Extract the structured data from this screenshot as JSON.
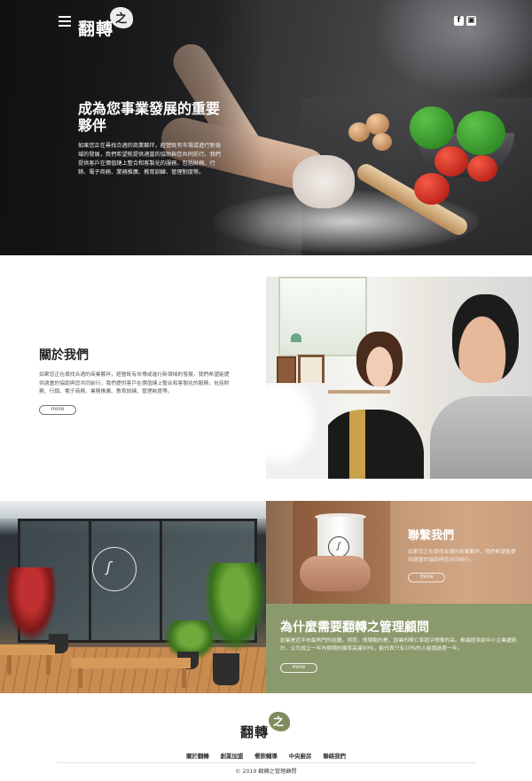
{
  "header": {
    "logo_text": "翻轉",
    "logo_badge": "之",
    "social": [
      {
        "icon": "facebook-icon",
        "glyph": "f"
      },
      {
        "icon": "line-icon",
        "glyph": "▣"
      }
    ]
  },
  "hero": {
    "title": "成為您事業發展的重要夥伴",
    "description": "如果您正在尋找合適的商業夥伴，經營既有市場或進行新領域的發展，我們希望能提供適當的協助與您共同前行。我們提供客戶在價值鏈上整合和客製化的服務，包括財務、行銷、電子商務、業務推廣、教育訓練、管理制度等。"
  },
  "about": {
    "title": "關於我們",
    "description": "如果您正在尋找合適的商業夥伴，經營既有市場或進行新領域的發展，我們希望能提供適當的協助與您共同前行，我們提供客戶在價值鏈上整合和客製化的服務，包括財務、行銷、電子商務、業務推廣、教育訓練、管理制度等。",
    "button": "more"
  },
  "cafe": {
    "sign_glyph": "ʃ"
  },
  "contact": {
    "title": "聯繫我們",
    "description": "如果您正在尋找合適的商業夥伴，我們希望能提供適當的協助與您共同前行。",
    "button": "more",
    "cup_glyph": "ʃ"
  },
  "why": {
    "title": "為什麼需要翻轉之管理顧問",
    "description": "創業是近年來最熱門的話題，然而，很殘酷的是，創業的陣亡率超乎想像的高。根據經濟部中小企業處統計，公司成立一年內倒閉的機率高達90%，能代表只有10%的人能撐過第一年。",
    "button": "more"
  },
  "footer": {
    "logo_text": "翻轉",
    "logo_badge": "之",
    "nav": [
      "關於翻轉",
      "創業加盟",
      "餐飲輔導",
      "中央廚房",
      "聯絡我們"
    ],
    "copyright": "© 2019 翻轉之管理顧問"
  },
  "colors": {
    "olive": "#8b9a6c",
    "footer_badge": "#7e8c5e",
    "contact_tan": "#b48a68"
  }
}
